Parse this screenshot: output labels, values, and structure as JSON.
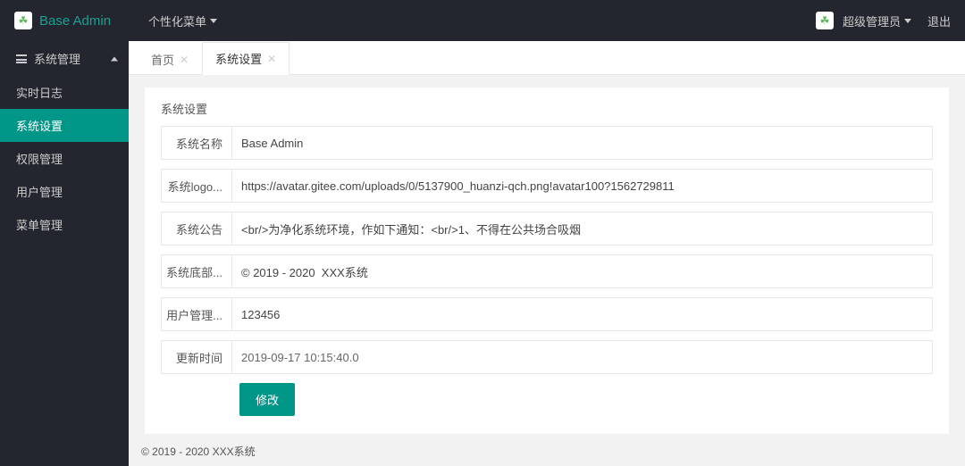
{
  "brand": "Base Admin",
  "top_menu": {
    "label": "个性化菜单"
  },
  "user": {
    "name": "超级管理员"
  },
  "logout": "退出",
  "sidebar": {
    "group": "系统管理",
    "items": [
      {
        "label": "实时日志",
        "active": false
      },
      {
        "label": "系统设置",
        "active": true
      },
      {
        "label": "权限管理",
        "active": false
      },
      {
        "label": "用户管理",
        "active": false
      },
      {
        "label": "菜单管理",
        "active": false
      }
    ]
  },
  "tabs": [
    {
      "label": "首页",
      "active": false
    },
    {
      "label": "系统设置",
      "active": true
    }
  ],
  "panel": {
    "title": "系统设置",
    "fields": [
      {
        "label": "系统名称",
        "value": "Base Admin"
      },
      {
        "label": "系统logo...",
        "value": "https://avatar.gitee.com/uploads/0/5137900_huanzi-qch.png!avatar100?1562729811"
      },
      {
        "label": "系统公告",
        "value": "<br/>为净化系统环境，作如下通知：<br/>1、不得在公共场合吸烟"
      },
      {
        "label": "系统底部...",
        "value": "© 2019 - 2020  XXX系统"
      },
      {
        "label": "用户管理...",
        "value": "123456"
      },
      {
        "label": "更新时间",
        "value": "2019-09-17 10:15:40.0"
      }
    ],
    "submit": "修改"
  },
  "footer": "© 2019 - 2020 XXX系统"
}
